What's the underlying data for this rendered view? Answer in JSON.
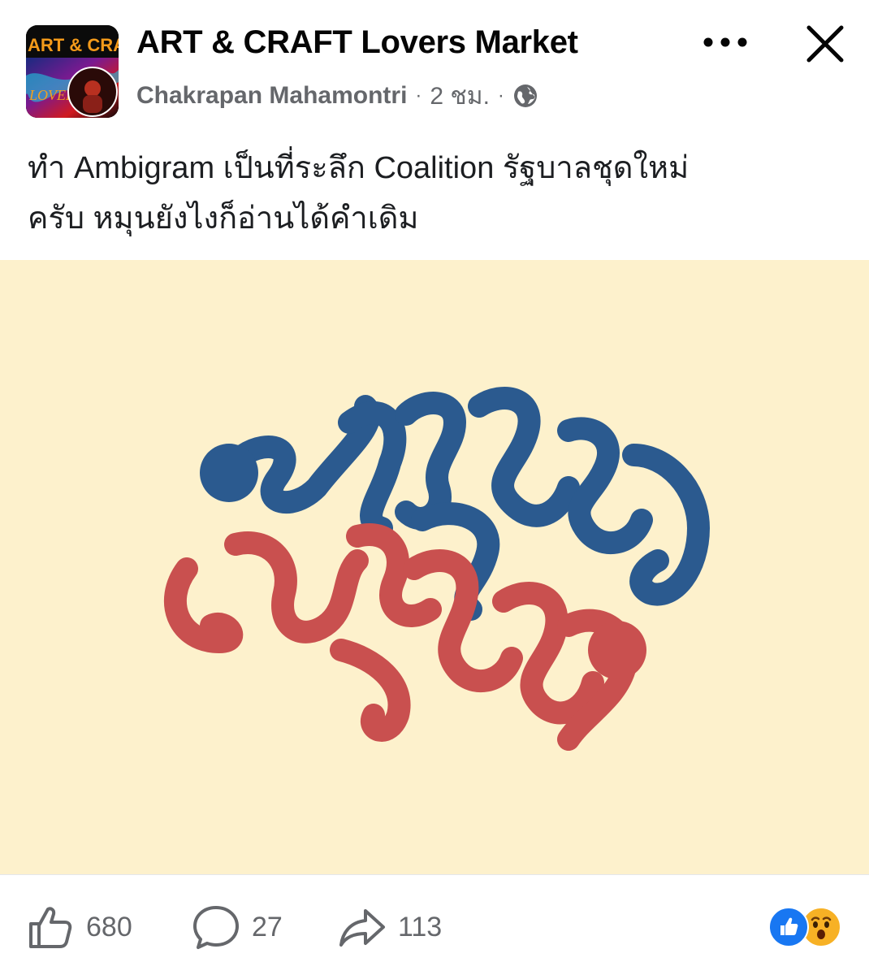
{
  "header": {
    "group_name": "ART & CRAFT Lovers Market",
    "author": "Chakrapan Mahamontri",
    "separator": "·",
    "time": "2 ชม.",
    "privacy_icon": "globe-icon",
    "more_icon": "more-horizontal-icon",
    "close_icon": "close-icon"
  },
  "avatar": {
    "line1": "ART & CRA",
    "line2": "LOVER"
  },
  "post": {
    "caption": "ทำ Ambigram เป็นที่ระลึก Coalition รัฐบาลชุดใหม่\nครับ หมุนยังไงก็อ่านได้คำเดิม",
    "image_colors": {
      "background": "#fdf1cc",
      "blue": "#2b5a8f",
      "red": "#c9504f"
    }
  },
  "footer": {
    "like_count": "680",
    "comment_count": "27",
    "share_count": "113",
    "like_icon": "thumbs-up-icon",
    "comment_icon": "comment-bubble-icon",
    "share_icon": "share-arrow-icon",
    "reactions": [
      "like-reaction-icon",
      "wow-reaction-icon"
    ]
  }
}
